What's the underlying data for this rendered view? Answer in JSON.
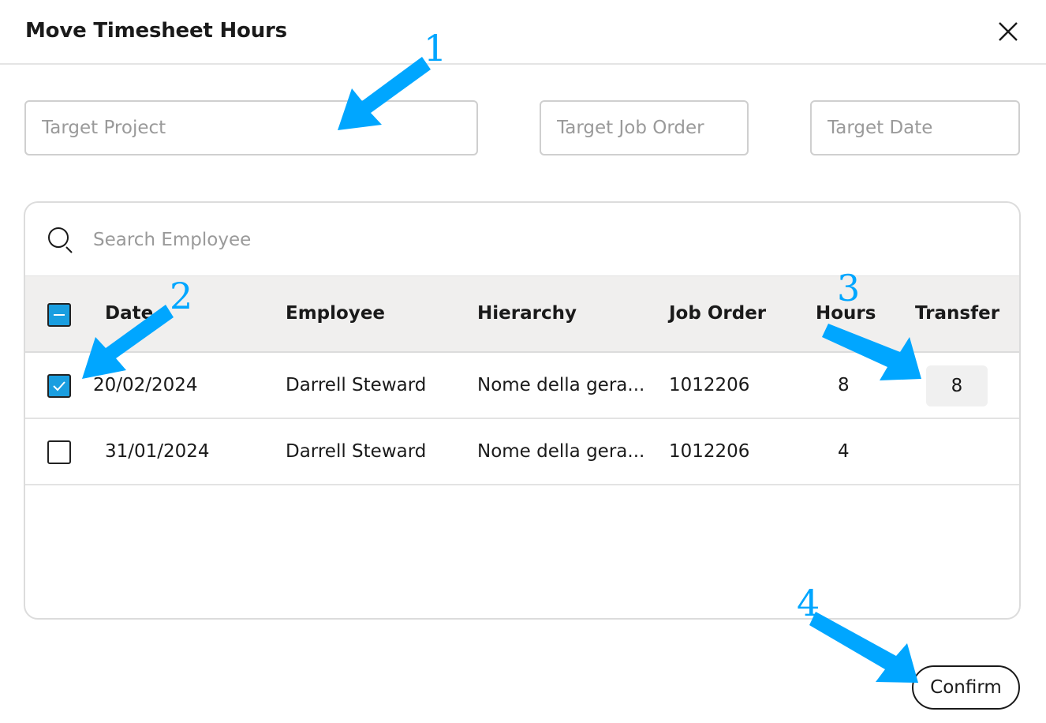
{
  "dialog": {
    "title": "Move Timesheet Hours",
    "close_icon": "close-icon"
  },
  "targets": {
    "project_placeholder": "Target Project",
    "job_order_placeholder": "Target Job Order",
    "date_placeholder": "Target Date"
  },
  "search": {
    "placeholder": "Search Employee",
    "icon": "search-icon"
  },
  "table": {
    "headers": {
      "date": "Date",
      "employee": "Employee",
      "hierarchy": "Hierarchy",
      "job_order": "Job Order",
      "hours": "Hours",
      "transfer": "Transfer"
    },
    "select_all_state": "indeterminate",
    "rows": [
      {
        "checked": true,
        "date": "20/02/2024",
        "employee": "Darrell Steward",
        "hierarchy": "Nome della gera...",
        "job_order": "1012206",
        "hours": "8",
        "transfer": "8"
      },
      {
        "checked": false,
        "date": "31/01/2024",
        "employee": "Darrell Steward",
        "hierarchy": "Nome della gera...",
        "job_order": "1012206",
        "hours": "4",
        "transfer": ""
      }
    ]
  },
  "actions": {
    "confirm_label": "Confirm"
  },
  "annotations": {
    "color": "#00a6ff",
    "labels": [
      "1",
      "2",
      "3",
      "4"
    ]
  },
  "colors": {
    "accent": "#1a9ee0",
    "header_bg": "#f0efee"
  }
}
